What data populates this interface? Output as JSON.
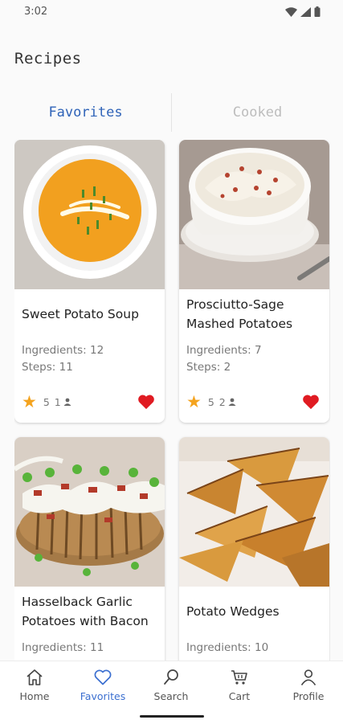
{
  "status": {
    "time": "3:02"
  },
  "page": {
    "title": "Recipes"
  },
  "tabs": [
    {
      "label": "Favorites",
      "active": true
    },
    {
      "label": "Cooked",
      "active": false
    }
  ],
  "recipes": [
    {
      "title": "Sweet Potato Soup",
      "ingredients": "Ingredients: 12",
      "steps": "Steps: 11",
      "rating": "5",
      "cooks": "1",
      "favorite": true,
      "image": "orange soup in white bowl"
    },
    {
      "title": "Prosciutto-Sage Mashed Potatoes",
      "ingredients": "Ingredients: 7",
      "steps": "Steps: 2",
      "rating": "5",
      "cooks": "2",
      "favorite": true,
      "image": "mashed potatoes in white bowl"
    },
    {
      "title": "Hasselback Garlic Potatoes with Bacon",
      "ingredients": "Ingredients: 11",
      "image": "hasselback potato with bacon"
    },
    {
      "title": "Potato Wedges",
      "ingredients": "Ingredients: 10",
      "image": "roasted potato wedges"
    }
  ],
  "nav": [
    {
      "label": "Home",
      "icon": "home-icon",
      "active": false
    },
    {
      "label": "Favorites",
      "icon": "heart-icon",
      "active": true
    },
    {
      "label": "Search",
      "icon": "search-icon",
      "active": false
    },
    {
      "label": "Cart",
      "icon": "cart-icon",
      "active": false
    },
    {
      "label": "Profile",
      "icon": "profile-icon",
      "active": false
    }
  ],
  "colors": {
    "accent": "#2f63b8",
    "star": "#f4a31e",
    "heart": "#e01b22"
  }
}
